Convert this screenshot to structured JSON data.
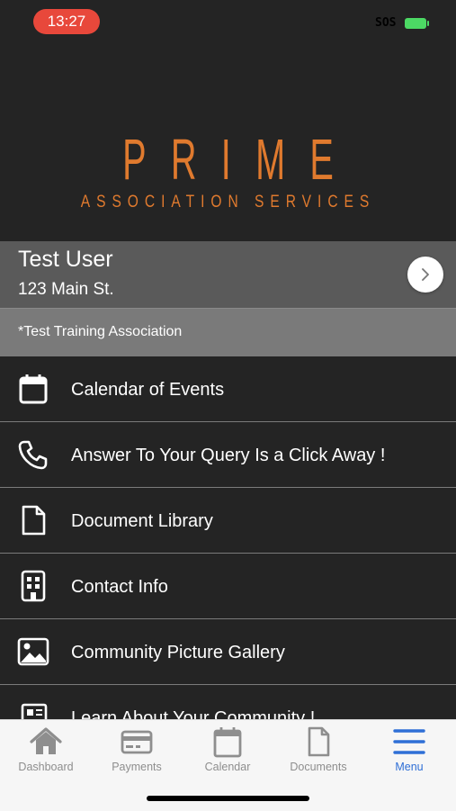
{
  "status_bar": {
    "time": "13:27",
    "carrier": "SOS"
  },
  "logo": {
    "main": "PRIME",
    "sub": "ASSOCIATION SERVICES"
  },
  "user": {
    "name": "Test User",
    "address": "123 Main St."
  },
  "association": {
    "label": "*Test Training Association"
  },
  "menu": {
    "items": [
      {
        "label": "Calendar of Events",
        "icon": "calendar-icon"
      },
      {
        "label": "Answer To Your Query Is a Click Away !",
        "icon": "phone-icon"
      },
      {
        "label": "Document Library",
        "icon": "document-icon"
      },
      {
        "label": "Contact Info",
        "icon": "building-icon"
      },
      {
        "label": "Community Picture Gallery",
        "icon": "image-icon"
      },
      {
        "label": "Learn About Your Community !",
        "icon": "newspaper-icon"
      }
    ]
  },
  "tabs": [
    {
      "label": "Dashboard",
      "icon": "home-icon"
    },
    {
      "label": "Payments",
      "icon": "credit-card-icon"
    },
    {
      "label": "Calendar",
      "icon": "calendar-icon"
    },
    {
      "label": "Documents",
      "icon": "document-icon"
    },
    {
      "label": "Menu",
      "icon": "hamburger-icon",
      "active": true
    }
  ],
  "colors": {
    "background": "#242424",
    "brand_orange": "#e07a2e",
    "active_tab": "#2f6fd6",
    "status_pill": "#e8483b"
  }
}
